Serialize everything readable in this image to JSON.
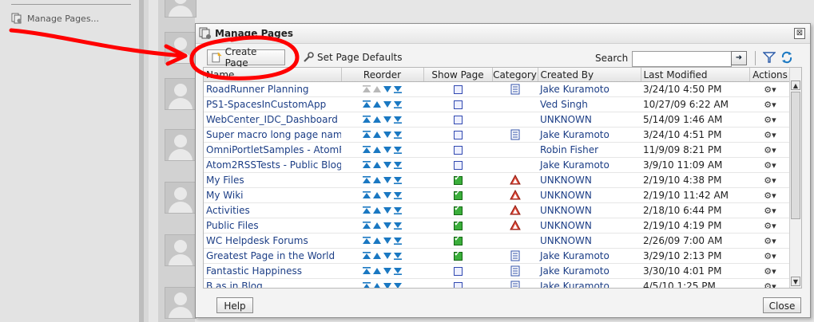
{
  "left_panel": {
    "manage_pages_link": "Manage Pages..."
  },
  "dialog": {
    "title": "Manage Pages",
    "close_glyph": "⊠",
    "toolbar": {
      "create_page": "Create Page",
      "set_page_defaults": "Set Page Defaults",
      "search_label": "Search",
      "search_value": "",
      "go_glyph": "➜"
    },
    "columns": [
      "Name",
      "Reorder",
      "Show Page",
      "Category",
      "Created By",
      "Last Modified",
      "Actions"
    ],
    "rows": [
      {
        "name": "RoadRunner Planning",
        "show": "off",
        "category": "doc",
        "created_by": "Jake Kuramoto",
        "modified": "3/24/10 4:50 PM",
        "first": true
      },
      {
        "name": "PS1-SpacesInCustomApp",
        "show": "off",
        "category": "",
        "created_by": "Ved Singh",
        "modified": "10/27/09 6:22 AM"
      },
      {
        "name": "WebCenter_IDC_Dashboard",
        "show": "off",
        "category": "",
        "created_by": "UNKNOWN",
        "modified": "5/14/09 1:46 AM"
      },
      {
        "name": "Super macro long page name f",
        "show": "off",
        "category": "doc",
        "created_by": "Jake Kuramoto",
        "modified": "3/24/10 4:51 PM"
      },
      {
        "name": "OmniPortletSamples - AtomFee",
        "show": "off",
        "category": "",
        "created_by": "Robin Fisher",
        "modified": "11/9/09 8:21 PM"
      },
      {
        "name": "Atom2RSSTests - Public Blog",
        "show": "off",
        "category": "",
        "created_by": "Jake Kuramoto",
        "modified": "3/9/10 11:09 AM"
      },
      {
        "name": "My Files",
        "show": "on",
        "category": "tri",
        "created_by": "UNKNOWN",
        "modified": "2/19/10 4:38 PM"
      },
      {
        "name": "My Wiki",
        "show": "on",
        "category": "tri",
        "created_by": "UNKNOWN",
        "modified": "2/19/10 11:42 AM"
      },
      {
        "name": "Activities",
        "show": "on",
        "category": "tri",
        "created_by": "UNKNOWN",
        "modified": "2/18/10 6:44 PM"
      },
      {
        "name": "Public Files",
        "show": "on",
        "category": "tri",
        "created_by": "UNKNOWN",
        "modified": "2/19/10 4:19 PM"
      },
      {
        "name": "WC Helpdesk Forums",
        "show": "on",
        "category": "",
        "created_by": "UNKNOWN",
        "modified": "2/26/09 7:00 AM"
      },
      {
        "name": "Greatest Page in the World",
        "show": "on",
        "category": "doc",
        "created_by": "Jake Kuramoto",
        "modified": "3/29/10 2:13 PM"
      },
      {
        "name": "Fantastic Happiness",
        "show": "off",
        "category": "doc",
        "created_by": "Jake Kuramoto",
        "modified": "3/30/10 4:01 PM"
      },
      {
        "name": "B as in Blog",
        "show": "off",
        "category": "doc",
        "created_by": "Jake Kuramoto",
        "modified": "4/5/10 1:25 PM"
      }
    ],
    "help_button": "Help",
    "close_button": "Close"
  },
  "colors": {
    "link": "#1c3e86",
    "annotation": "#ff0000",
    "reorder_icon": "#1a78c2"
  }
}
